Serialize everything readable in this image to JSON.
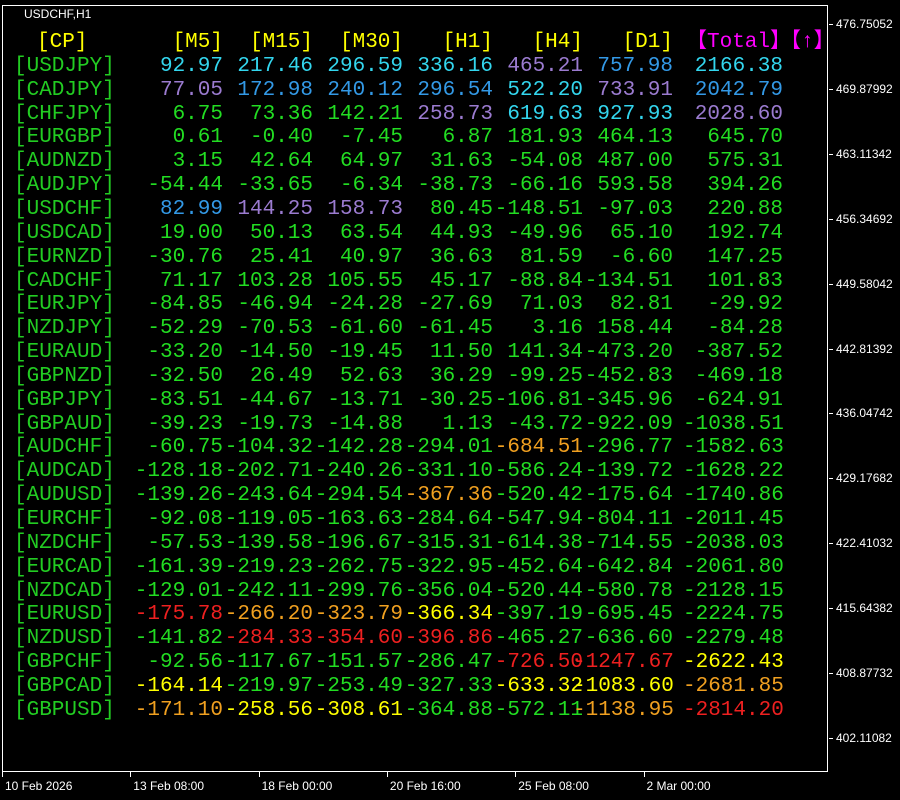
{
  "chart": {
    "symbol": "USDCHF,H1"
  },
  "colors": {
    "cyan": "#33d6ee",
    "blue": "#3399e6",
    "purple": "#9b7bd0",
    "green": "#22dd22",
    "yellow": "#ffff00",
    "orange": "#f0a020",
    "red": "#ee2020",
    "label": "#22cc22",
    "header": "#ffff00",
    "total": "#ff00ff"
  },
  "headers": {
    "cp": "[CP]",
    "cols": [
      "[M5]",
      "[M15]",
      "[M30]",
      "[H1]",
      "[H4]",
      "[D1]"
    ],
    "total": "【Total】",
    "arrow": "【↑】"
  },
  "rows": [
    {
      "pair": "[USDJPY]",
      "cells": [
        [
          "92.97",
          "cyan"
        ],
        [
          "217.46",
          "cyan"
        ],
        [
          "296.59",
          "cyan"
        ],
        [
          "336.16",
          "cyan"
        ],
        [
          "465.21",
          "purple"
        ],
        [
          "757.98",
          "blue"
        ],
        [
          "2166.38",
          "cyan"
        ]
      ]
    },
    {
      "pair": "[CADJPY]",
      "cells": [
        [
          "77.05",
          "purple"
        ],
        [
          "172.98",
          "blue"
        ],
        [
          "240.12",
          "blue"
        ],
        [
          "296.54",
          "blue"
        ],
        [
          "522.20",
          "cyan"
        ],
        [
          "733.91",
          "purple"
        ],
        [
          "2042.79",
          "blue"
        ]
      ]
    },
    {
      "pair": "[CHFJPY]",
      "cells": [
        [
          "6.75",
          "green"
        ],
        [
          "73.36",
          "green"
        ],
        [
          "142.21",
          "green"
        ],
        [
          "258.73",
          "purple"
        ],
        [
          "619.63",
          "cyan"
        ],
        [
          "927.93",
          "cyan"
        ],
        [
          "2028.60",
          "purple"
        ]
      ]
    },
    {
      "pair": "[EURGBP]",
      "cells": [
        [
          "0.61",
          "green"
        ],
        [
          "-0.40",
          "green"
        ],
        [
          "-7.45",
          "green"
        ],
        [
          "6.87",
          "green"
        ],
        [
          "181.93",
          "green"
        ],
        [
          "464.13",
          "green"
        ],
        [
          "645.70",
          "green"
        ]
      ]
    },
    {
      "pair": "[AUDNZD]",
      "cells": [
        [
          "3.15",
          "green"
        ],
        [
          "42.64",
          "green"
        ],
        [
          "64.97",
          "green"
        ],
        [
          "31.63",
          "green"
        ],
        [
          "-54.08",
          "green"
        ],
        [
          "487.00",
          "green"
        ],
        [
          "575.31",
          "green"
        ]
      ]
    },
    {
      "pair": "[AUDJPY]",
      "cells": [
        [
          "-54.44",
          "green"
        ],
        [
          "-33.65",
          "green"
        ],
        [
          "-6.34",
          "green"
        ],
        [
          "-38.73",
          "green"
        ],
        [
          "-66.16",
          "green"
        ],
        [
          "593.58",
          "green"
        ],
        [
          "394.26",
          "green"
        ]
      ]
    },
    {
      "pair": "[USDCHF]",
      "cells": [
        [
          "82.99",
          "blue"
        ],
        [
          "144.25",
          "purple"
        ],
        [
          "158.73",
          "purple"
        ],
        [
          "80.45",
          "green"
        ],
        [
          "-148.51",
          "green"
        ],
        [
          "-97.03",
          "green"
        ],
        [
          "220.88",
          "green"
        ]
      ]
    },
    {
      "pair": "[USDCAD]",
      "cells": [
        [
          "19.00",
          "green"
        ],
        [
          "50.13",
          "green"
        ],
        [
          "63.54",
          "green"
        ],
        [
          "44.93",
          "green"
        ],
        [
          "-49.96",
          "green"
        ],
        [
          "65.10",
          "green"
        ],
        [
          "192.74",
          "green"
        ]
      ]
    },
    {
      "pair": "[EURNZD]",
      "cells": [
        [
          "-30.76",
          "green"
        ],
        [
          "25.41",
          "green"
        ],
        [
          "40.97",
          "green"
        ],
        [
          "36.63",
          "green"
        ],
        [
          "81.59",
          "green"
        ],
        [
          "-6.60",
          "green"
        ],
        [
          "147.25",
          "green"
        ]
      ]
    },
    {
      "pair": "[CADCHF]",
      "cells": [
        [
          "71.17",
          "green"
        ],
        [
          "103.28",
          "green"
        ],
        [
          "105.55",
          "green"
        ],
        [
          "45.17",
          "green"
        ],
        [
          "-88.84",
          "green"
        ],
        [
          "-134.51",
          "green"
        ],
        [
          "101.83",
          "green"
        ]
      ]
    },
    {
      "pair": "[EURJPY]",
      "cells": [
        [
          "-84.85",
          "green"
        ],
        [
          "-46.94",
          "green"
        ],
        [
          "-24.28",
          "green"
        ],
        [
          "-27.69",
          "green"
        ],
        [
          "71.03",
          "green"
        ],
        [
          "82.81",
          "green"
        ],
        [
          "-29.92",
          "green"
        ]
      ]
    },
    {
      "pair": "[NZDJPY]",
      "cells": [
        [
          "-52.29",
          "green"
        ],
        [
          "-70.53",
          "green"
        ],
        [
          "-61.60",
          "green"
        ],
        [
          "-61.45",
          "green"
        ],
        [
          "3.16",
          "green"
        ],
        [
          "158.44",
          "green"
        ],
        [
          "-84.28",
          "green"
        ]
      ]
    },
    {
      "pair": "[EURAUD]",
      "cells": [
        [
          "-33.20",
          "green"
        ],
        [
          "-14.50",
          "green"
        ],
        [
          "-19.45",
          "green"
        ],
        [
          "11.50",
          "green"
        ],
        [
          "141.34",
          "green"
        ],
        [
          "-473.20",
          "green"
        ],
        [
          "-387.52",
          "green"
        ]
      ]
    },
    {
      "pair": "[GBPNZD]",
      "cells": [
        [
          "-32.50",
          "green"
        ],
        [
          "26.49",
          "green"
        ],
        [
          "52.63",
          "green"
        ],
        [
          "36.29",
          "green"
        ],
        [
          "-99.25",
          "green"
        ],
        [
          "-452.83",
          "green"
        ],
        [
          "-469.18",
          "green"
        ]
      ]
    },
    {
      "pair": "[GBPJPY]",
      "cells": [
        [
          "-83.51",
          "green"
        ],
        [
          "-44.67",
          "green"
        ],
        [
          "-13.71",
          "green"
        ],
        [
          "-30.25",
          "green"
        ],
        [
          "-106.81",
          "green"
        ],
        [
          "-345.96",
          "green"
        ],
        [
          "-624.91",
          "green"
        ]
      ]
    },
    {
      "pair": "[GBPAUD]",
      "cells": [
        [
          "-39.23",
          "green"
        ],
        [
          "-19.73",
          "green"
        ],
        [
          "-14.88",
          "green"
        ],
        [
          "1.13",
          "green"
        ],
        [
          "-43.72",
          "green"
        ],
        [
          "-922.09",
          "green"
        ],
        [
          "-1038.51",
          "green"
        ]
      ]
    },
    {
      "pair": "[AUDCHF]",
      "cells": [
        [
          "-60.75",
          "green"
        ],
        [
          "-104.32",
          "green"
        ],
        [
          "-142.28",
          "green"
        ],
        [
          "-294.01",
          "green"
        ],
        [
          "-684.51",
          "orange"
        ],
        [
          "-296.77",
          "green"
        ],
        [
          "-1582.63",
          "green"
        ]
      ]
    },
    {
      "pair": "[AUDCAD]",
      "cells": [
        [
          "-128.18",
          "green"
        ],
        [
          "-202.71",
          "green"
        ],
        [
          "-240.26",
          "green"
        ],
        [
          "-331.10",
          "green"
        ],
        [
          "-586.24",
          "green"
        ],
        [
          "-139.72",
          "green"
        ],
        [
          "-1628.22",
          "green"
        ]
      ]
    },
    {
      "pair": "[AUDUSD]",
      "cells": [
        [
          "-139.26",
          "green"
        ],
        [
          "-243.64",
          "green"
        ],
        [
          "-294.54",
          "green"
        ],
        [
          "-367.36",
          "orange"
        ],
        [
          "-520.42",
          "green"
        ],
        [
          "-175.64",
          "green"
        ],
        [
          "-1740.86",
          "green"
        ]
      ]
    },
    {
      "pair": "[EURCHF]",
      "cells": [
        [
          "-92.08",
          "green"
        ],
        [
          "-119.05",
          "green"
        ],
        [
          "-163.63",
          "green"
        ],
        [
          "-284.64",
          "green"
        ],
        [
          "-547.94",
          "green"
        ],
        [
          "-804.11",
          "green"
        ],
        [
          "-2011.45",
          "green"
        ]
      ]
    },
    {
      "pair": "[NZDCHF]",
      "cells": [
        [
          "-57.53",
          "green"
        ],
        [
          "-139.58",
          "green"
        ],
        [
          "-196.67",
          "green"
        ],
        [
          "-315.31",
          "green"
        ],
        [
          "-614.38",
          "green"
        ],
        [
          "-714.55",
          "green"
        ],
        [
          "-2038.03",
          "green"
        ]
      ]
    },
    {
      "pair": "[EURCAD]",
      "cells": [
        [
          "-161.39",
          "green"
        ],
        [
          "-219.23",
          "green"
        ],
        [
          "-262.75",
          "green"
        ],
        [
          "-322.95",
          "green"
        ],
        [
          "-452.64",
          "green"
        ],
        [
          "-642.84",
          "green"
        ],
        [
          "-2061.80",
          "green"
        ]
      ]
    },
    {
      "pair": "[NZDCAD]",
      "cells": [
        [
          "-129.01",
          "green"
        ],
        [
          "-242.11",
          "green"
        ],
        [
          "-299.76",
          "green"
        ],
        [
          "-356.04",
          "green"
        ],
        [
          "-520.44",
          "green"
        ],
        [
          "-580.78",
          "green"
        ],
        [
          "-2128.15",
          "green"
        ]
      ]
    },
    {
      "pair": "[EURUSD]",
      "cells": [
        [
          "-175.78",
          "red"
        ],
        [
          "-266.20",
          "orange"
        ],
        [
          "-323.79",
          "orange"
        ],
        [
          "-366.34",
          "yellow"
        ],
        [
          "-397.19",
          "green"
        ],
        [
          "-695.45",
          "green"
        ],
        [
          "-2224.75",
          "green"
        ]
      ]
    },
    {
      "pair": "[NZDUSD]",
      "cells": [
        [
          "-141.82",
          "green"
        ],
        [
          "-284.33",
          "red"
        ],
        [
          "-354.60",
          "red"
        ],
        [
          "-396.86",
          "red"
        ],
        [
          "-465.27",
          "green"
        ],
        [
          "-636.60",
          "green"
        ],
        [
          "-2279.48",
          "green"
        ]
      ]
    },
    {
      "pair": "[GBPCHF]",
      "cells": [
        [
          "-92.56",
          "green"
        ],
        [
          "-117.67",
          "green"
        ],
        [
          "-151.57",
          "green"
        ],
        [
          "-286.47",
          "green"
        ],
        [
          "-726.50",
          "red"
        ],
        [
          "-1247.67",
          "red"
        ],
        [
          "-2622.43",
          "yellow"
        ]
      ]
    },
    {
      "pair": "[GBPCAD]",
      "cells": [
        [
          "-164.14",
          "yellow"
        ],
        [
          "-219.97",
          "green"
        ],
        [
          "-253.49",
          "green"
        ],
        [
          "-327.33",
          "green"
        ],
        [
          "-633.32",
          "yellow"
        ],
        [
          "-1083.60",
          "yellow"
        ],
        [
          "-2681.85",
          "orange"
        ]
      ]
    },
    {
      "pair": "[GBPUSD]",
      "cells": [
        [
          "-171.10",
          "orange"
        ],
        [
          "-258.56",
          "yellow"
        ],
        [
          "-308.61",
          "yellow"
        ],
        [
          "-364.88",
          "green"
        ],
        [
          "-572.11",
          "green"
        ],
        [
          "-1138.95",
          "orange"
        ],
        [
          "-2814.20",
          "red"
        ]
      ]
    }
  ],
  "price_axis": [
    "476.75052",
    "469.87992",
    "463.11342",
    "456.34692",
    "449.58042",
    "442.81392",
    "436.04742",
    "429.17682",
    "422.41032",
    "415.64382",
    "408.87732",
    "402.11082"
  ],
  "time_axis": [
    "10 Feb 2026",
    "13 Feb 08:00",
    "18 Feb 00:00",
    "20 Feb 16:00",
    "25 Feb 08:00",
    "2 Mar 00:00"
  ]
}
